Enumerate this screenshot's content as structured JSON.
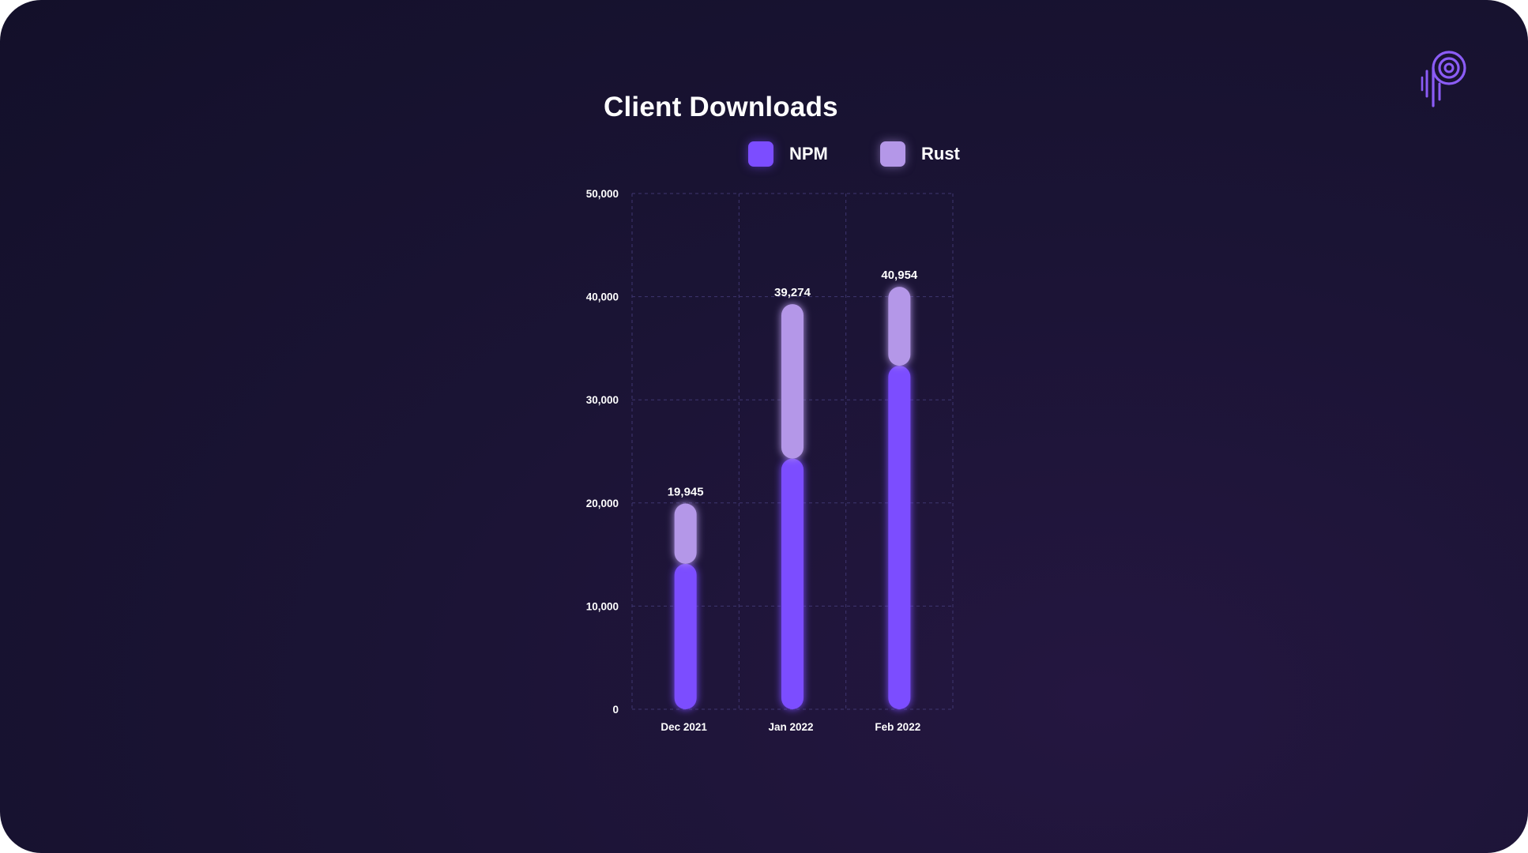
{
  "brand": {
    "logo_icon": "p-logo-icon",
    "accent": "#7c4dff"
  },
  "chart_data": {
    "type": "bar",
    "stacked": true,
    "title": "Client Downloads",
    "categories": [
      "Dec 2021",
      "Jan 2022",
      "Feb 2022"
    ],
    "series": [
      {
        "name": "NPM",
        "color": "#7c4dff",
        "values": [
          14100,
          24300,
          33300
        ]
      },
      {
        "name": "Rust",
        "color": "#b497e8",
        "values": [
          5845,
          14974,
          7654
        ]
      }
    ],
    "totals": [
      19945,
      39274,
      40954
    ],
    "total_labels": [
      "19,945",
      "39,274",
      "40,954"
    ],
    "ylim": [
      0,
      50000
    ],
    "yticks": [
      0,
      10000,
      20000,
      30000,
      40000,
      50000
    ],
    "ytick_labels": [
      "0",
      "10,000",
      "20,000",
      "30,000",
      "40,000",
      "50,000"
    ],
    "xlabel": "",
    "ylabel": "",
    "grid": true,
    "legend_position": "top"
  }
}
